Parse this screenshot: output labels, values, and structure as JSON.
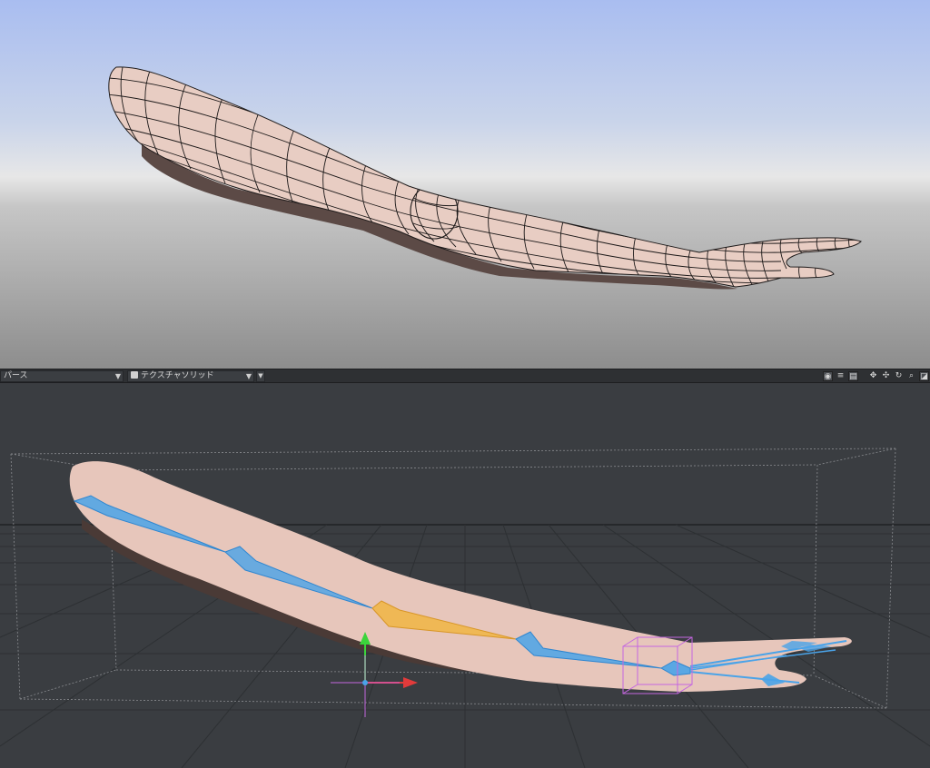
{
  "toolbar": {
    "view_mode_label": "パース",
    "shading_label": "テクスチャソリッド",
    "icons": [
      "camera-icon",
      "list-icon",
      "save-icon",
      "move-icon",
      "pan-icon",
      "rotate-icon",
      "zoom-icon",
      "maximize-icon"
    ]
  },
  "colors": {
    "skin": "#e7c6bb",
    "bone_blue": "#4aa3e8",
    "bone_selected": "#f0b64a",
    "axis_x": "#e23b3b",
    "axis_y": "#3bd43b",
    "pivot": "#c466e0",
    "viewport_bg": "#3a3d41"
  }
}
